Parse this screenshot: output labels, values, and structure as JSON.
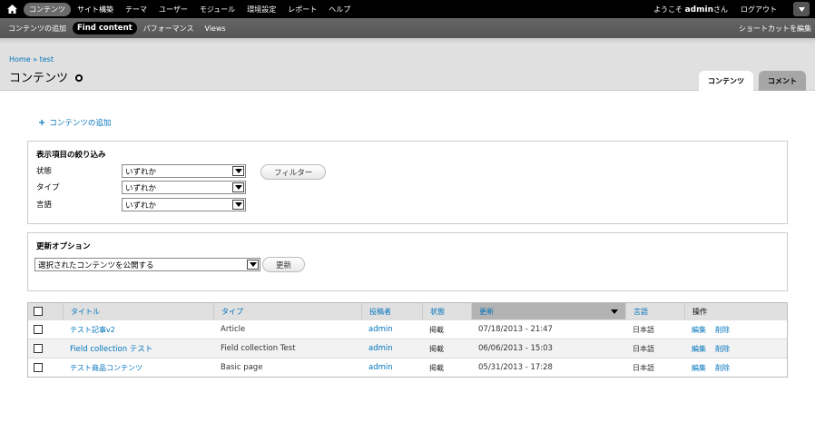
{
  "toolbar": {
    "menu": [
      "コンテンツ",
      "サイト構築",
      "テーマ",
      "ユーザー",
      "モジュール",
      "環境設定",
      "レポート",
      "ヘルプ"
    ],
    "welcome_prefix": "ようこそ",
    "username": "admin",
    "welcome_suffix": "さん",
    "logout": "ログアウト"
  },
  "shortcuts": {
    "items": [
      "コンテンツの追加",
      "Find content",
      "パフォーマンス",
      "Views"
    ],
    "edit": "ショートカットを編集"
  },
  "header": {
    "breadcrumb_home": "Home",
    "breadcrumb_sep": " » ",
    "breadcrumb_current": "test",
    "title": "コンテンツ",
    "tabs": [
      "コンテンツ",
      "コメント"
    ]
  },
  "content": {
    "add_link": "コンテンツの追加",
    "filter": {
      "title": "表示項目の絞り込み",
      "status_label": "状態",
      "type_label": "タイプ",
      "lang_label": "言語",
      "status_value": "いずれか",
      "type_value": "いずれか",
      "lang_value": "いずれか",
      "button": "フィルター"
    },
    "update": {
      "title": "更新オプション",
      "select_value": "選択されたコンテンツを公開する",
      "button": "更新"
    }
  },
  "table": {
    "headers": {
      "title": "タイトル",
      "type": "タイプ",
      "author": "投稿者",
      "status": "状態",
      "updated": "更新",
      "language": "言語",
      "operations": "操作"
    },
    "rows": [
      {
        "title": "テスト記事v2",
        "type": "Article",
        "author": "admin",
        "status": "掲載",
        "updated": "07/18/2013 - 21:47",
        "language": "日本語",
        "edit": "編集",
        "delete": "削除"
      },
      {
        "title": "Field collection テスト",
        "type": "Field collection Test",
        "author": "admin",
        "status": "掲載",
        "updated": "06/06/2013 - 15:03",
        "language": "日本語",
        "edit": "編集",
        "delete": "削除"
      },
      {
        "title": "テスト商品コンテンツ",
        "type": "Basic page",
        "author": "admin",
        "status": "掲載",
        "updated": "05/31/2013 - 17:28",
        "language": "日本語",
        "edit": "編集",
        "delete": "削除"
      }
    ]
  }
}
